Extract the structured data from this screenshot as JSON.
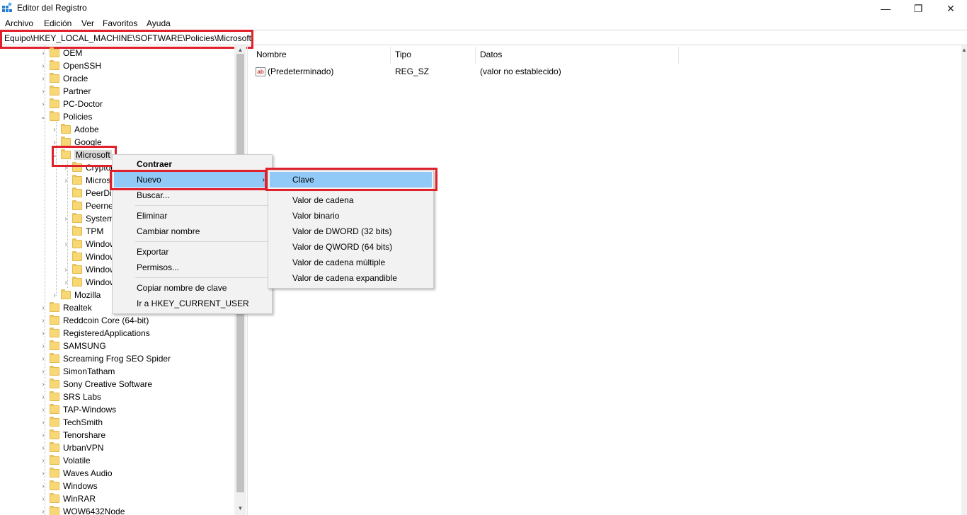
{
  "window": {
    "title": "Editor del Registro",
    "minimize": "—",
    "restore": "❐",
    "close": "✕"
  },
  "menu": [
    "Archivo",
    "Edición",
    "Ver",
    "Favoritos",
    "Ayuda"
  ],
  "address": "Equipo\\HKEY_LOCAL_MACHINE\\SOFTWARE\\Policies\\Microsoft",
  "tree": {
    "top_items": [
      "OEM",
      "OpenSSH",
      "Oracle",
      "Partner",
      "PC-Doctor"
    ],
    "policies": "Policies",
    "policies_children_before": [
      "Adobe",
      "Google"
    ],
    "selected": "Microsoft",
    "microsoft_children": [
      "Cryptography",
      "Microsoft",
      "PeerDist",
      "Peernet",
      "SystemCertificates",
      "TPM",
      "Windows",
      "Windows Defender",
      "Windows NT",
      "WindowsStore"
    ],
    "mozilla": "Mozilla",
    "bottom_items": [
      "Realtek",
      "Reddcoin Core (64-bit)",
      "RegisteredApplications",
      "SAMSUNG",
      "Screaming Frog SEO Spider",
      "SimonTatham",
      "Sony Creative Software",
      "SRS Labs",
      "TAP-Windows",
      "TechSmith",
      "Tenorshare",
      "UrbanVPN",
      "Volatile",
      "Waves Audio",
      "Windows",
      "WinRAR",
      "WOW6432Node"
    ]
  },
  "list": {
    "columns": [
      "Nombre",
      "Tipo",
      "Datos"
    ],
    "rows": [
      {
        "name": "(Predeterminado)",
        "type": "REG_SZ",
        "data": "(valor no establecido)"
      }
    ]
  },
  "context_menu": {
    "collapse": "Contraer",
    "new": "Nuevo",
    "find": "Buscar...",
    "delete": "Eliminar",
    "rename": "Cambiar nombre",
    "export": "Exportar",
    "permissions": "Permisos...",
    "copy_key_name": "Copiar nombre de clave",
    "goto_hkcu": "Ir a HKEY_CURRENT_USER",
    "submenu_arrow": "›"
  },
  "submenu": {
    "key": "Clave",
    "items": [
      "Valor de cadena",
      "Valor binario",
      "Valor de DWORD (32 bits)",
      "Valor de QWORD (64 bits)",
      "Valor de cadena múltiple",
      "Valor de cadena expandible"
    ]
  },
  "colors": {
    "highlight": "#91c9f7",
    "annotation_red": "#e0202a",
    "folder": "#f8d775"
  }
}
